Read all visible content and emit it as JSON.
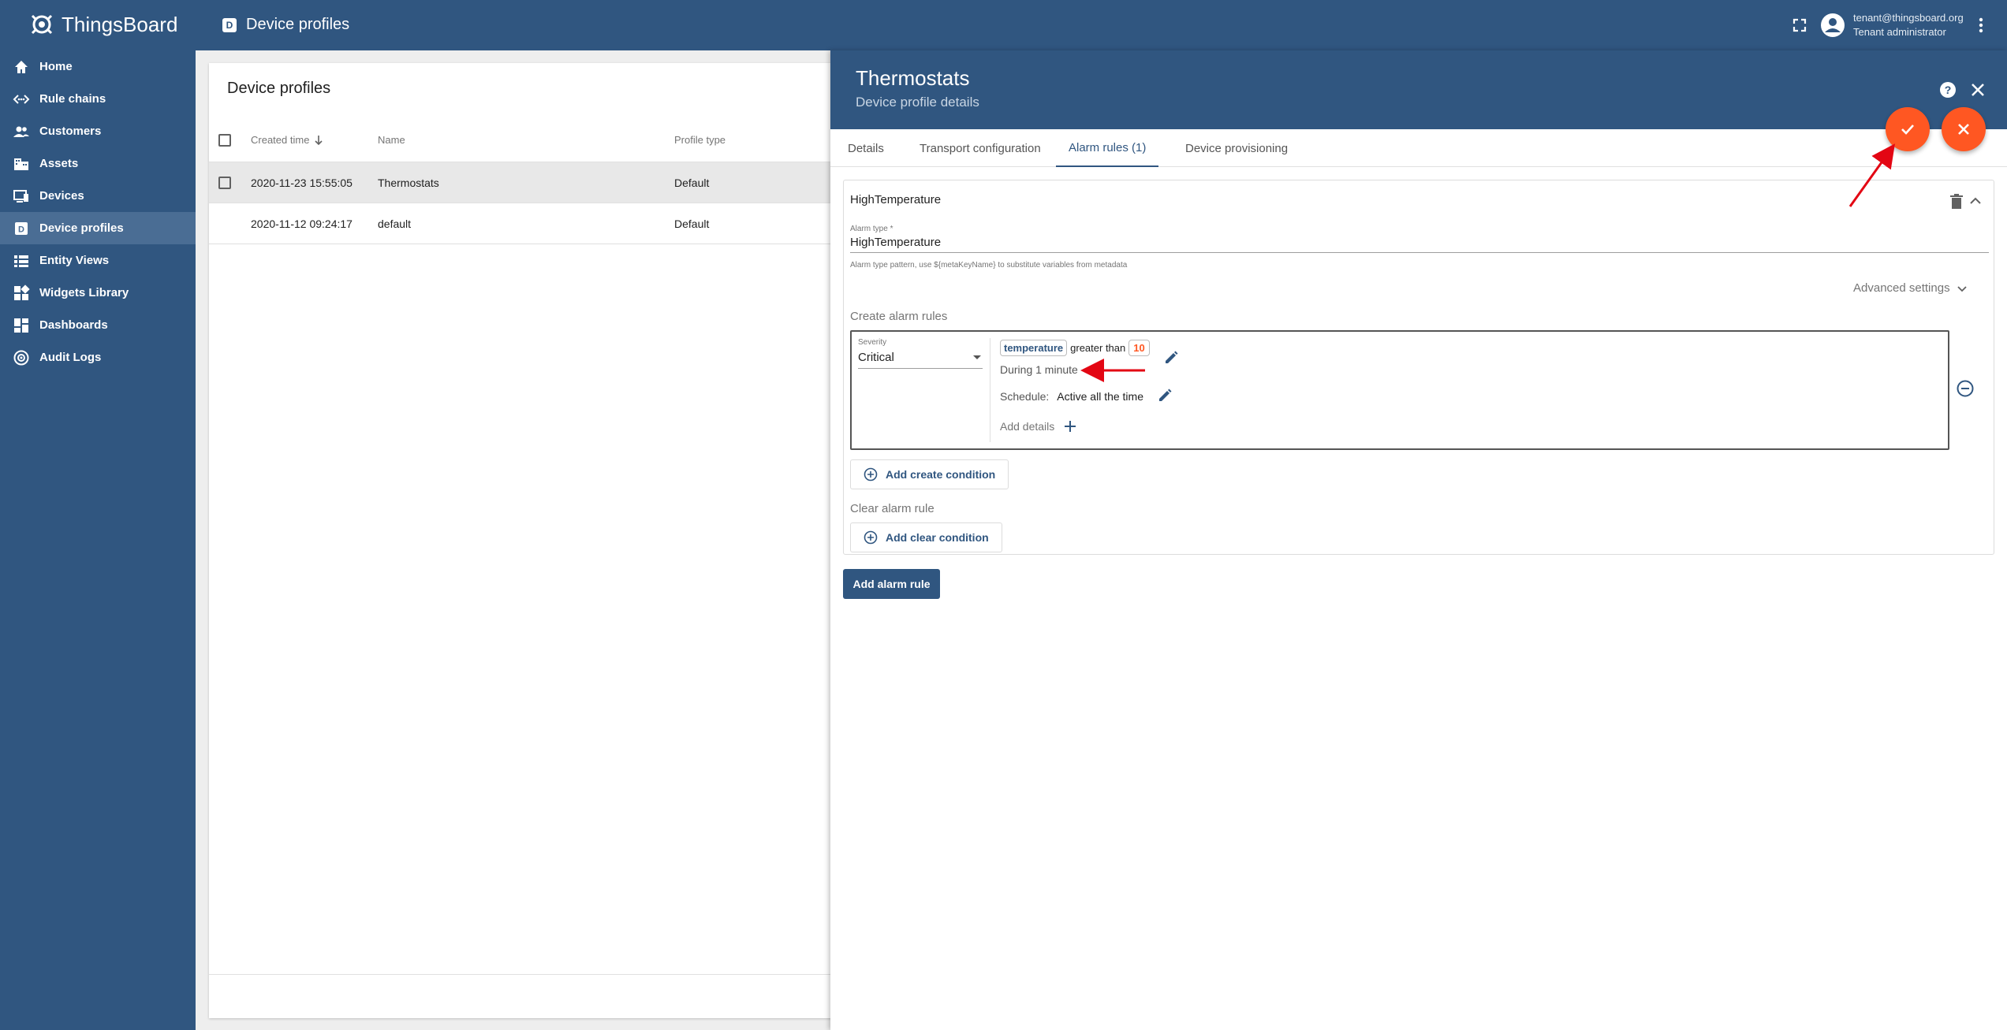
{
  "app": {
    "name": "ThingsBoard"
  },
  "topbar": {
    "title": "Device profiles",
    "title_badge": "D"
  },
  "user": {
    "email": "tenant@thingsboard.org",
    "role": "Tenant administrator"
  },
  "sidebar": {
    "items": [
      {
        "label": "Home",
        "icon": "home-icon"
      },
      {
        "label": "Rule chains",
        "icon": "rule-chains-icon"
      },
      {
        "label": "Customers",
        "icon": "customers-icon"
      },
      {
        "label": "Assets",
        "icon": "assets-icon"
      },
      {
        "label": "Devices",
        "icon": "devices-icon"
      },
      {
        "label": "Device profiles",
        "icon": "device-profiles-icon",
        "active": true
      },
      {
        "label": "Entity Views",
        "icon": "entity-views-icon"
      },
      {
        "label": "Widgets Library",
        "icon": "widgets-icon"
      },
      {
        "label": "Dashboards",
        "icon": "dashboards-icon"
      },
      {
        "label": "Audit Logs",
        "icon": "audit-logs-icon"
      }
    ]
  },
  "list": {
    "title": "Device profiles",
    "columns": [
      "Created time",
      "Name",
      "Profile type"
    ],
    "rows": [
      {
        "created": "2020-11-23 15:55:05",
        "name": "Thermostats",
        "type": "Default"
      },
      {
        "created": "2020-11-12 09:24:17",
        "name": "default",
        "type": "Default"
      }
    ]
  },
  "details": {
    "title": "Thermostats",
    "subtitle": "Device profile details",
    "tabs": [
      "Details",
      "Transport configuration",
      "Alarm rules (1)",
      "Device provisioning"
    ],
    "active_tab": "Alarm rules (1)"
  },
  "alarm": {
    "name": "HighTemperature",
    "type_label": "Alarm type *",
    "type_value": "HighTemperature",
    "type_hint": "Alarm type pattern, use ${metaKeyName} to substitute variables from metadata",
    "advanced_settings": "Advanced settings",
    "create_label": "Create alarm rules",
    "severity_label": "Severity",
    "severity_value": "Critical",
    "condition_key": "temperature",
    "condition_op": "greater than",
    "condition_value": "10",
    "duration": "During 1 minute",
    "schedule_label": "Schedule:",
    "schedule_value": "Active all the time",
    "add_details": "Add details",
    "add_create_condition": "Add create condition",
    "clear_label": "Clear alarm rule",
    "add_clear_condition": "Add clear condition",
    "add_alarm_rule": "Add alarm rule"
  },
  "colors": {
    "primary": "#305680",
    "accent": "#ff5722",
    "annotation": "#e30613"
  }
}
